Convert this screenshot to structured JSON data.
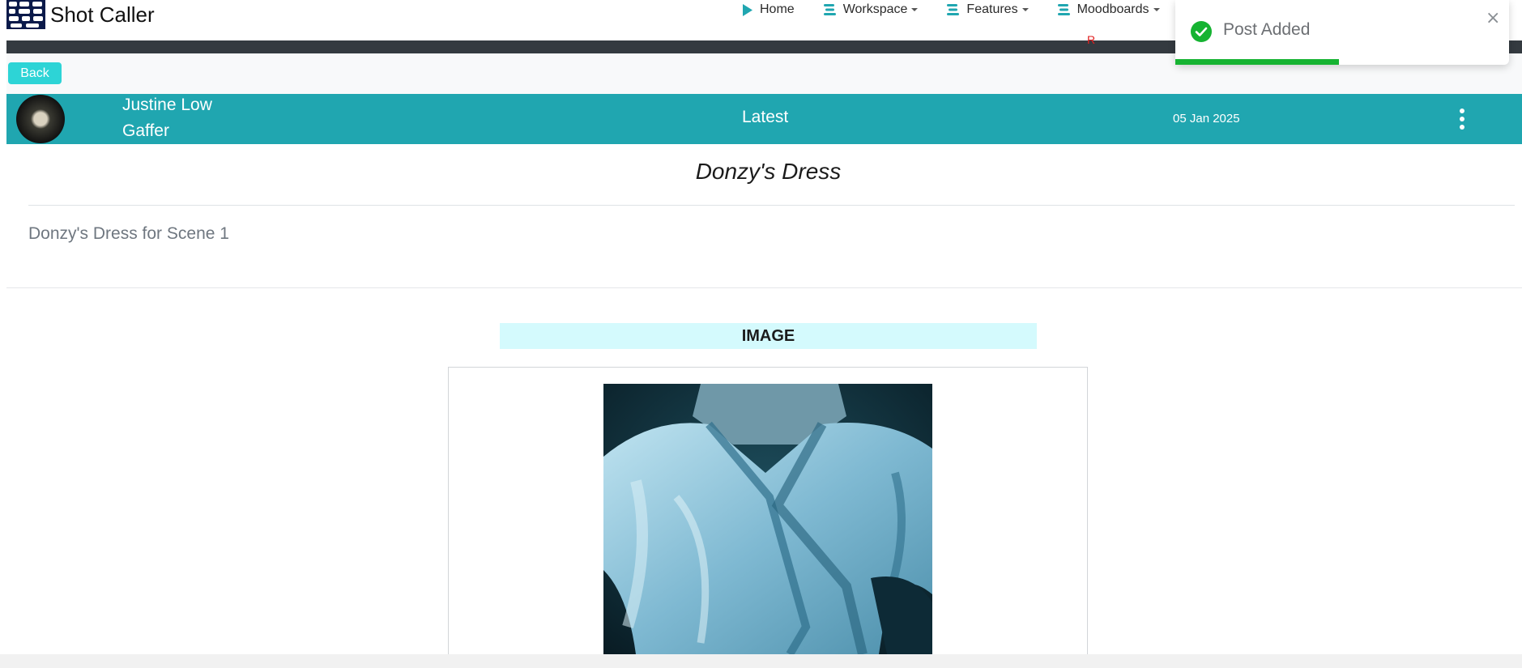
{
  "app": {
    "brand_name": "Shot Caller"
  },
  "nav": {
    "items": [
      {
        "label": "Home",
        "icon": "play-icon",
        "has_dropdown": false
      },
      {
        "label": "Workspace",
        "icon": "menu-lines-icon",
        "has_dropdown": true
      },
      {
        "label": "Features",
        "icon": "menu-lines-icon",
        "has_dropdown": true
      },
      {
        "label": "Moodboards",
        "icon": "menu-lines-icon",
        "has_dropdown": true
      }
    ],
    "stray_mark": "R"
  },
  "page": {
    "back_label": "Back"
  },
  "post": {
    "author_name": "Justine Low",
    "author_role": "Gaffer",
    "status": "Latest",
    "date": "05 Jan 2025",
    "title": "Donzy's Dress",
    "description": "Donzy's Dress for Scene 1",
    "media_label": "IMAGE"
  },
  "toast": {
    "message": "Post Added",
    "close_glyph": "×",
    "progress": 0.49
  },
  "colors": {
    "accent": "#20a6b0",
    "button": "#2dd4d6",
    "success": "#16b332",
    "dark_bar": "#343a40",
    "media_label_bg": "#d4fafd"
  }
}
